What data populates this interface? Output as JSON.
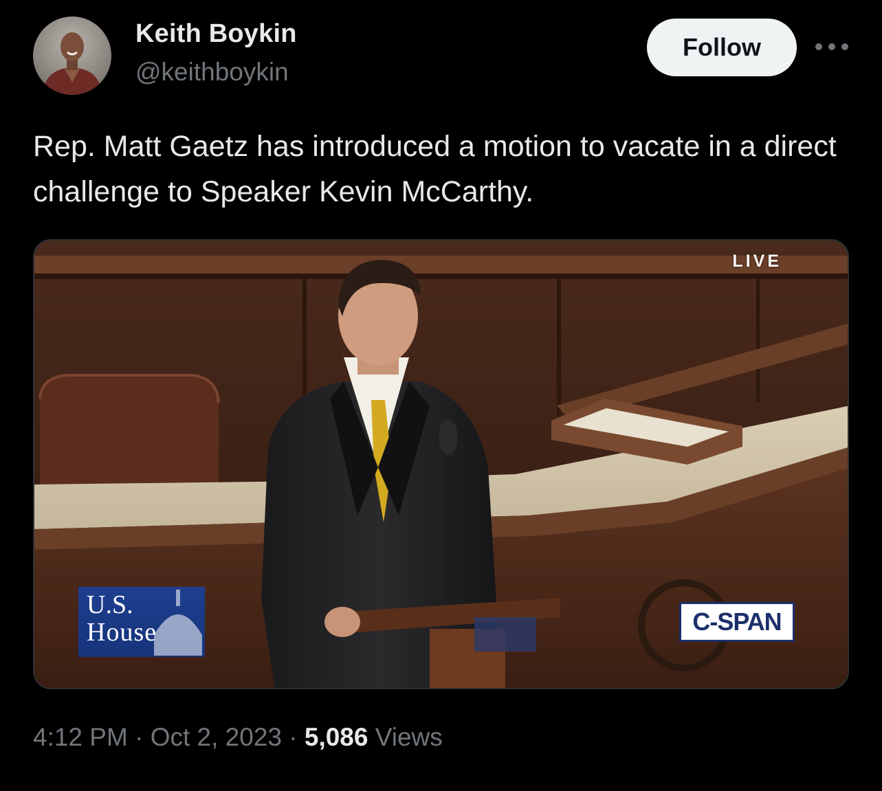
{
  "author": {
    "display_name": "Keith Boykin",
    "handle": "@keithboykin",
    "avatar_icon": "profile-photo"
  },
  "actions": {
    "follow_label": "Follow",
    "more_icon": "more-horizontal-icon"
  },
  "tweet": {
    "text": "Rep. Matt Gaetz has introduced a motion to vacate in a direct challenge to Speaker Kevin McCarthy."
  },
  "media": {
    "live_label": "LIVE",
    "house_logo_line1": "U.S.",
    "house_logo_line2": "House",
    "network_logo": "C-SPAN"
  },
  "meta": {
    "time": "4:12 PM",
    "separator": " · ",
    "date": "Oct 2, 2023",
    "views_count": "5,086",
    "views_label": "Views"
  },
  "colors": {
    "background": "#000000",
    "primary_text": "#e7e9ea",
    "secondary_text": "#71767b",
    "follow_button_bg": "#eff3f4",
    "media_border": "#2f3336"
  }
}
